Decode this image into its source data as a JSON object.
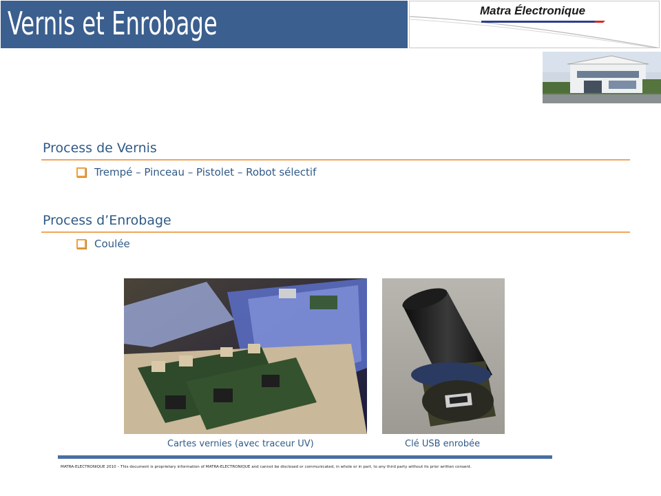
{
  "header": {
    "title": "Vernis et Enrobage",
    "brand": "Matra Électronique"
  },
  "sections": [
    {
      "title": "Process de Vernis",
      "bullet": "Trempé – Pinceau – Pistolet – Robot sélectif"
    },
    {
      "title": "Process d’Enrobage",
      "bullet": "Coulée"
    }
  ],
  "figures": [
    {
      "caption": "Cartes vernies (avec traceur UV)"
    },
    {
      "caption": "Clé USB enrobée"
    }
  ],
  "footer": {
    "notice": "MATRA-ELECTRONIQUE 2010 – This document is proprietary information of MATRA-ELECTRONIQUE and cannot be disclosed or communicated, in whole or in part, to any third party without its prior written consent."
  },
  "colors": {
    "title_bar": "#3b5f8e",
    "section_text": "#2f5a87",
    "rule": "#f0a55a",
    "footer_bar": "#4a6fa1"
  },
  "icons": [
    "checkbox-bullet-icon"
  ]
}
